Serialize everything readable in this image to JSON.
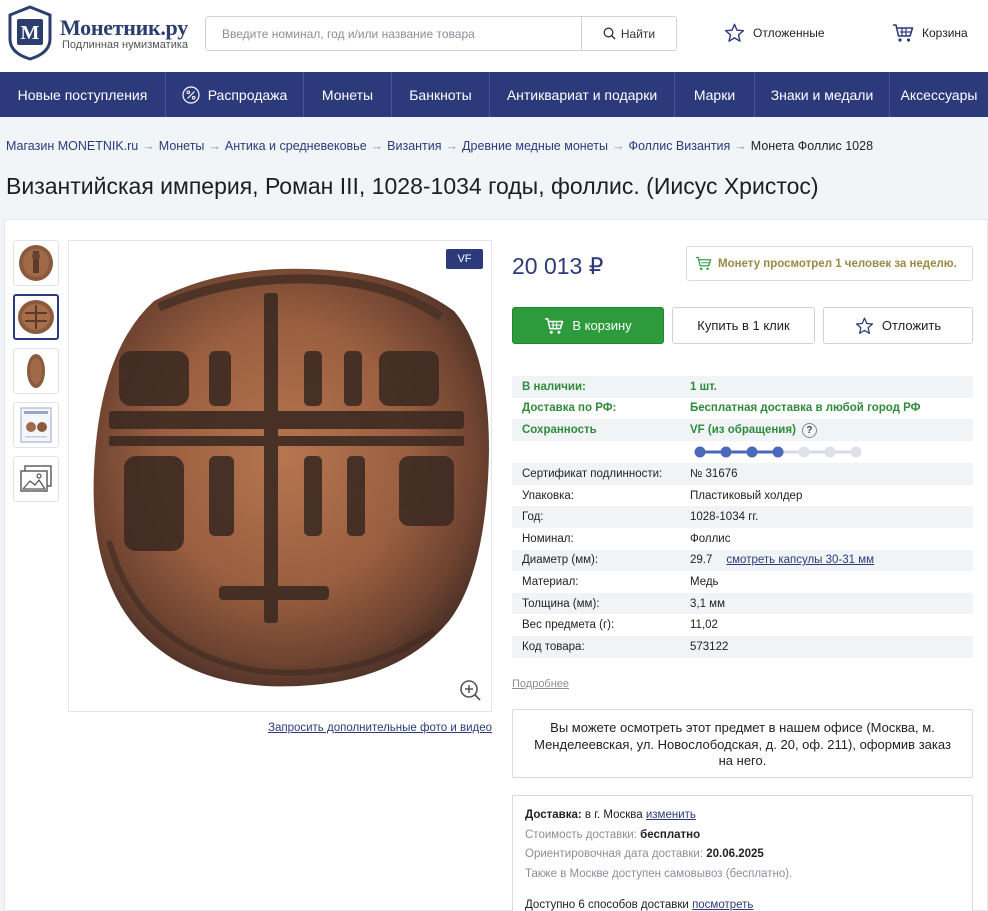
{
  "header": {
    "logo_name": "Монетник.ру",
    "logo_sub": "Подлинная нумизматика",
    "search_placeholder": "Введите номинал, год и/или название товара",
    "search_button": "Найти",
    "favorites": "Отложенные",
    "cart": "Корзина"
  },
  "nav": [
    {
      "label": "Новые поступления",
      "width": 166
    },
    {
      "label": "Распродажа",
      "width": 138,
      "icon": "percent-icon"
    },
    {
      "label": "Монеты",
      "width": 88
    },
    {
      "label": "Банкноты",
      "width": 98
    },
    {
      "label": "Антиквариат и подарки",
      "width": 185
    },
    {
      "label": "Марки",
      "width": 80
    },
    {
      "label": "Знаки и медали",
      "width": 135
    },
    {
      "label": "Аксессуары",
      "width": 98
    }
  ],
  "breadcrumbs": [
    "Магазин MONETNIK.ru",
    "Монеты",
    "Антика и средневековье",
    "Византия",
    "Древние медные монеты",
    "Фоллис Византия"
  ],
  "breadcrumb_current": "Монета Фоллис 1028",
  "title": "Византийская империя, Роман III, 1028-1034 годы, фоллис. (Иисус Христос)",
  "grade_badge": "VF",
  "request_photo": "Запросить дополнительные фото и видео",
  "price": "20 013 ₽",
  "view_notice": "Монету просмотрел 1 человек за неделю.",
  "buttons": {
    "cart": "В корзину",
    "one_click": "Купить в 1 клик",
    "defer": "Отложить"
  },
  "specs_top": [
    {
      "k": "В наличии:",
      "v": "1 шт."
    },
    {
      "k": "Доставка по РФ:",
      "v": "Бесплатная доставка в любой город РФ"
    }
  ],
  "condition": {
    "k": "Сохранность",
    "v": "VF (из обращения)",
    "help": "?",
    "level": 4,
    "max": 7
  },
  "specs": [
    {
      "k": "Сертификат подлинности:",
      "v": "№ 31676"
    },
    {
      "k": "Упаковка:",
      "v": "Пластиковый холдер"
    },
    {
      "k": "Год:",
      "v": "1028-1034 гг."
    },
    {
      "k": "Номинал:",
      "v": "Фоллис"
    },
    {
      "k": "Диаметр (мм):",
      "v": "29.7",
      "link": "смотреть капсулы 30-31 мм"
    },
    {
      "k": "Материал:",
      "v": "Медь"
    },
    {
      "k": "Толщина (мм):",
      "v": "3,1 мм"
    },
    {
      "k": "Вес предмета (г):",
      "v": "11,02"
    },
    {
      "k": "Код товара:",
      "v": "573122"
    }
  ],
  "more_link": "Подробнее",
  "office_text": "Вы можете осмотреть этот предмет в нашем офисе (Москва, м. Менделеевская, ул. Новослободская, д. 20, оф. 211), оформив заказ на него.",
  "delivery": {
    "label": "Доставка:",
    "city": "в г. Москва",
    "change": "изменить",
    "cost_label": "Стоимость доставки:",
    "cost": "бесплатно",
    "date_label": "Ориентировочная дата доставки:",
    "date": "20.06.2025",
    "pickup": "Также в Москве доступен самовывоз (бесплатно).",
    "methods": "Доступно 6 способов доставки",
    "methods_link": "посмотреть"
  }
}
